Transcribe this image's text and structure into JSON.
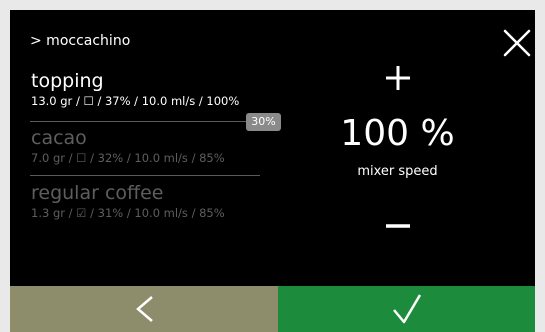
{
  "header": {
    "breadcrumb": "> moccachino",
    "close_icon": "close-icon"
  },
  "ingredients": [
    {
      "name": "topping",
      "details": "13.0 gr / ☐ / 37% / 10.0 ml/s / 100%",
      "state": "active"
    },
    {
      "name": "cacao",
      "details": "7.0 gr / ☐ / 32% / 10.0 ml/s / 85%",
      "state": "inactive"
    },
    {
      "name": "regular coffee",
      "details": "1.3 gr / ☑ / 31% / 10.0 ml/s / 85%",
      "state": "inactive"
    }
  ],
  "tooltip": {
    "text": "30%"
  },
  "control": {
    "value": "100",
    "unit": "%",
    "label": "mixer speed",
    "increase_icon": "plus-icon",
    "decrease_icon": "minus-icon"
  },
  "footer": {
    "back_icon": "chevron-left-icon",
    "confirm_icon": "checkmark-icon"
  },
  "colors": {
    "screen_background": "#000000",
    "active_text": "#ffffff",
    "inactive_text": "#5e5e5e",
    "back_button": "#8d8d6c",
    "confirm_button": "#1c8b3c",
    "tooltip": "#8a8a8a"
  }
}
